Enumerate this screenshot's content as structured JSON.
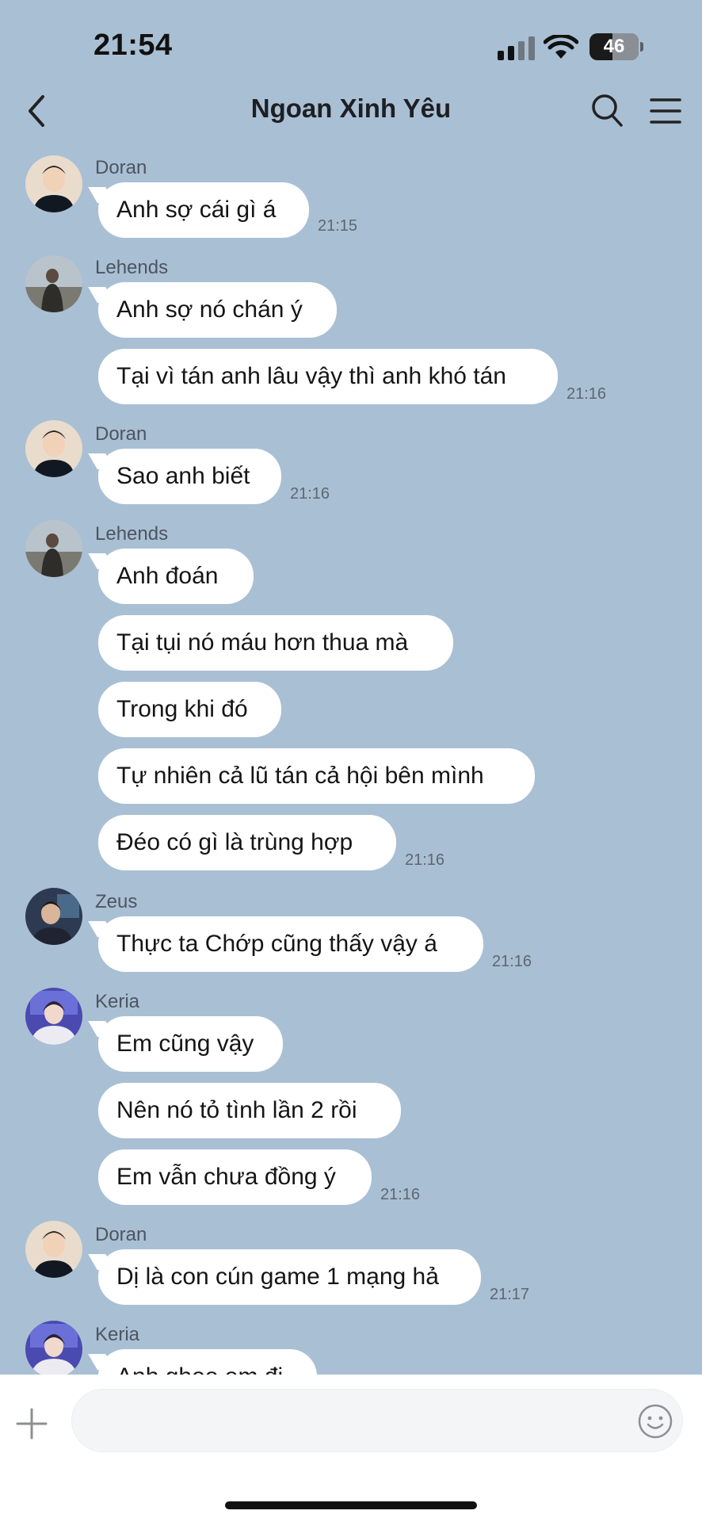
{
  "status": {
    "time": "21:54",
    "battery": "46",
    "battery_level_percent": 46
  },
  "header": {
    "title": "Ngoan Xinh Yêu"
  },
  "messages": [
    {
      "sender": "Doran",
      "text": "Anh sợ cái gì á",
      "time": "21:15"
    },
    {
      "sender": "Lehends",
      "text": "Anh sợ nó chán ý"
    },
    {
      "text": "Tại vì tán anh lâu vậy thì anh khó tán",
      "time": "21:16"
    },
    {
      "sender": "Doran",
      "text": "Sao anh biết",
      "time": "21:16"
    },
    {
      "sender": "Lehends",
      "text": "Anh đoán"
    },
    {
      "text": "Tại tụi nó máu hơn thua mà"
    },
    {
      "text": "Trong khi đó"
    },
    {
      "text": "Tự nhiên cả lũ tán cả hội bên mình"
    },
    {
      "text": "Đéo có gì là trùng hợp",
      "time": "21:16"
    },
    {
      "sender": "Zeus",
      "text": "Thực ta Chớp cũng thấy vậy á",
      "time": "21:16"
    },
    {
      "sender": "Keria",
      "text": "Em cũng vậy"
    },
    {
      "text": "Nên nó tỏ tình lần 2 rồi"
    },
    {
      "text": "Em vẫn chưa đồng ý",
      "time": "21:16"
    },
    {
      "sender": "Doran",
      "text": "Dị là con cún game 1 mạng hả",
      "time": "21:17"
    },
    {
      "sender": "Keria",
      "text": "Anh ghẹo em đi"
    }
  ],
  "composer": {
    "placeholder": ""
  },
  "colors": {
    "chat_bg": "#a9bfd4",
    "bubble": "#ffffff",
    "name_text": "#4d5560"
  },
  "icons": [
    "back-icon",
    "search-icon",
    "menu-icon",
    "plus-icon",
    "emoji-icon",
    "signal-icon",
    "wifi-icon"
  ]
}
